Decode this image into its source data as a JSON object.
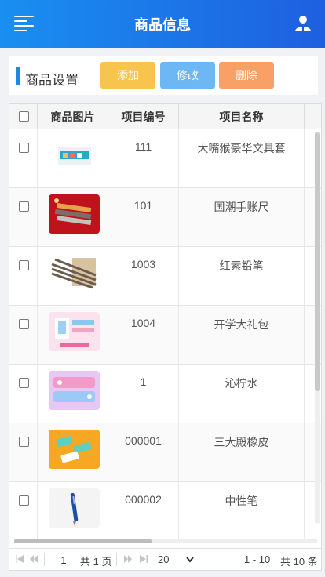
{
  "header": {
    "title": "商品信息"
  },
  "toolbar": {
    "title": "商品设置",
    "add_label": "添加",
    "edit_label": "修改",
    "delete_label": "删除"
  },
  "table": {
    "columns": [
      "商品图片",
      "项目编号",
      "项目名称"
    ],
    "rows": [
      {
        "code": "111",
        "name": "大嘴猴豪华文具套",
        "thumb": "stationery-set-icon"
      },
      {
        "code": "101",
        "name": "国潮手账尺",
        "thumb": "ruler-icon"
      },
      {
        "code": "1003",
        "name": "红素铅笔",
        "thumb": "pencil-icon"
      },
      {
        "code": "1004",
        "name": "开学大礼包",
        "thumb": "gift-pack-icon"
      },
      {
        "code": "1",
        "name": "沁柠水",
        "thumb": "drink-icon"
      },
      {
        "code": "000001",
        "name": "三大殿橡皮",
        "thumb": "eraser-icon"
      },
      {
        "code": "000002",
        "name": "中性笔",
        "thumb": "gel-pen-icon"
      }
    ]
  },
  "pager": {
    "page": "1",
    "total_pages": "共 1 页",
    "page_size": "20",
    "range": "1 - 10",
    "total": "共 10 条"
  },
  "colors": {
    "header_start": "#1a8ff0",
    "header_end": "#1e5fe0",
    "add": "#f7c54d",
    "edit": "#6eb7f5",
    "delete": "#f9a066"
  }
}
